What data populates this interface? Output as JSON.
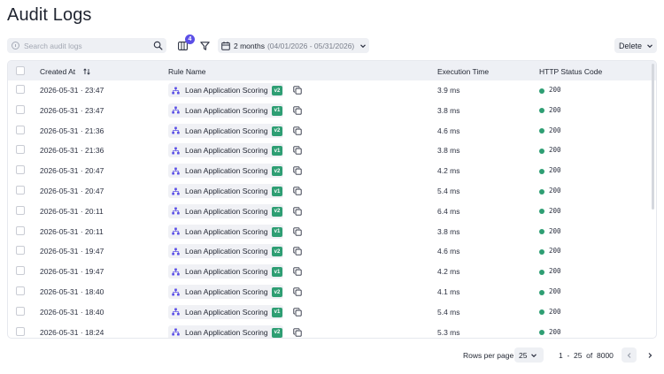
{
  "page": {
    "title": "Audit Logs"
  },
  "toolbar": {
    "search_placeholder": "Search audit logs",
    "columns_badge": "4",
    "date_range_main": "2 months",
    "date_range_detail": "(04/01/2026 - 05/31/2026)",
    "delete_label": "Delete"
  },
  "table": {
    "headers": {
      "created_at": "Created At",
      "rule_name": "Rule Name",
      "execution_time": "Execution Time",
      "http_status": "HTTP Status Code"
    },
    "rows": [
      {
        "created_at": "2026-05-31 · 23:47",
        "rule_name": "Loan Application Scoring",
        "version": "v2",
        "execution_time": "3.9 ms",
        "status_code": "200"
      },
      {
        "created_at": "2026-05-31 · 23:47",
        "rule_name": "Loan Application Scoring",
        "version": "v1",
        "execution_time": "3.8 ms",
        "status_code": "200"
      },
      {
        "created_at": "2026-05-31 · 21:36",
        "rule_name": "Loan Application Scoring",
        "version": "v2",
        "execution_time": "4.6 ms",
        "status_code": "200"
      },
      {
        "created_at": "2026-05-31 · 21:36",
        "rule_name": "Loan Application Scoring",
        "version": "v1",
        "execution_time": "3.8 ms",
        "status_code": "200"
      },
      {
        "created_at": "2026-05-31 · 20:47",
        "rule_name": "Loan Application Scoring",
        "version": "v2",
        "execution_time": "4.2 ms",
        "status_code": "200"
      },
      {
        "created_at": "2026-05-31 · 20:47",
        "rule_name": "Loan Application Scoring",
        "version": "v1",
        "execution_time": "5.4 ms",
        "status_code": "200"
      },
      {
        "created_at": "2026-05-31 · 20:11",
        "rule_name": "Loan Application Scoring",
        "version": "v2",
        "execution_time": "6.4 ms",
        "status_code": "200"
      },
      {
        "created_at": "2026-05-31 · 20:11",
        "rule_name": "Loan Application Scoring",
        "version": "v1",
        "execution_time": "3.8 ms",
        "status_code": "200"
      },
      {
        "created_at": "2026-05-31 · 19:47",
        "rule_name": "Loan Application Scoring",
        "version": "v2",
        "execution_time": "4.6 ms",
        "status_code": "200"
      },
      {
        "created_at": "2026-05-31 · 19:47",
        "rule_name": "Loan Application Scoring",
        "version": "v1",
        "execution_time": "4.2 ms",
        "status_code": "200"
      },
      {
        "created_at": "2026-05-31 · 18:40",
        "rule_name": "Loan Application Scoring",
        "version": "v2",
        "execution_time": "4.1 ms",
        "status_code": "200"
      },
      {
        "created_at": "2026-05-31 · 18:40",
        "rule_name": "Loan Application Scoring",
        "version": "v1",
        "execution_time": "5.4 ms",
        "status_code": "200"
      },
      {
        "created_at": "2026-05-31 · 18:24",
        "rule_name": "Loan Application Scoring",
        "version": "v2",
        "execution_time": "5.3 ms",
        "status_code": "200"
      }
    ]
  },
  "pagination": {
    "rows_per_page_label": "Rows per page",
    "rows_per_page_value": "25",
    "range_text": "1  -  25  of  8000"
  },
  "colors": {
    "accent": "#5b4fe6",
    "success": "#2e9e73",
    "chip_bg": "#f0f1f5"
  },
  "icons": {
    "search": "search-icon",
    "columns": "columns-icon",
    "filter": "filter-icon",
    "calendar": "calendar-icon",
    "rule": "flow-icon",
    "copy": "copy-icon"
  }
}
